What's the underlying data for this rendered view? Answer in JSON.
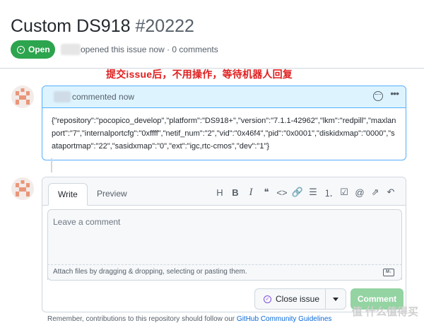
{
  "issue": {
    "title": "Custom DS918",
    "number": "#20222",
    "status": "Open",
    "meta": "opened this issue now · 0 comments"
  },
  "annotation": "提交issue后，不用操作，等待机器人回复",
  "comment": {
    "meta": "commented now",
    "body": "{\"repository\":\"pocopico_develop\",\"platform\":\"DS918+\",\"version\":\"7.1.1-42962\",\"lkm\":\"redpill\",\"maxlanport\":\"7\",\"internalportcfg\":\"0xffff\",\"netif_num\":\"2\",\"vid\":\"0x46f4\",\"pid\":\"0x0001\",\"diskidxmap\":\"0000\",\"sataportmap\":\"22\",\"sasidxmap\":\"0\",\"ext\":\"igc,rtc-cmos\",\"dev\":\"1\"}"
  },
  "composer": {
    "tabs": {
      "write": "Write",
      "preview": "Preview"
    },
    "toolbar": {
      "heading": "H",
      "bold": "B",
      "italic": "I",
      "quote": "❝",
      "code": "<>",
      "link": "🔗",
      "bulleted_list": "☰",
      "numbered_list": "⒈",
      "task_list": "☑",
      "mention": "@",
      "reference": "⇗",
      "reply": "↶"
    },
    "placeholder": "Leave a comment",
    "attach_text": "Attach files by dragging & dropping, selecting or pasting them.",
    "markdown_badge": "M↓",
    "close_button": "Close issue",
    "comment_button": "Comment"
  },
  "footer": {
    "text": "Remember, contributions to this repository should follow our",
    "link": "GitHub Community Guidelines"
  },
  "watermark": "值 什么值得买",
  "colors": {
    "open_green": "#2da44e",
    "accent_blue": "#54aeff",
    "annotation_red": "#e02020",
    "comment_button": "#94d3a2"
  }
}
